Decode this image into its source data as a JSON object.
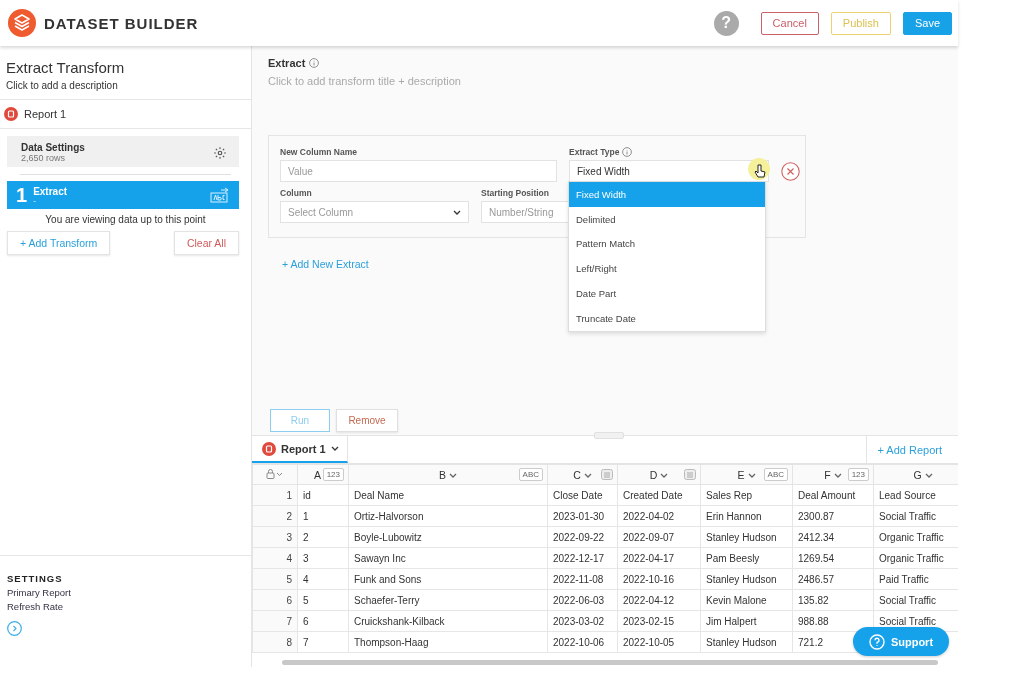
{
  "header": {
    "title": "DATASET BUILDER",
    "help": "?",
    "buttons": [
      {
        "label": "Cancel",
        "kind": "cancel"
      },
      {
        "label": "Publish",
        "kind": "publish"
      },
      {
        "label": "Save",
        "kind": "save"
      }
    ]
  },
  "sidebar": {
    "title": "Extract Transform",
    "description": "Click to add a description",
    "report": "Report 1",
    "data_settings": {
      "title": "Data Settings",
      "rows": "2,650 rows"
    },
    "steps": [
      {
        "number": "1",
        "title": "Extract",
        "subtitle": "-",
        "selected": true
      }
    ],
    "viewing_note": "You are viewing data up to this point",
    "buttons": [
      {
        "label": "+ Add Transform",
        "kind": "add"
      },
      {
        "label": "Clear All",
        "kind": "clear"
      }
    ],
    "settings": {
      "heading": "SETTINGS",
      "items": [
        "Primary Report",
        "Refresh Rate"
      ]
    }
  },
  "transform": {
    "title": "Extract",
    "description": "Click to add transform title + description",
    "fields": {
      "new_column_label": "New Column Name",
      "new_column_placeholder": "Value",
      "extract_type_label": "Extract Type",
      "extract_type_value": "Fixed Width",
      "column_label": "Column",
      "column_placeholder": "Select Column",
      "start_label": "Starting Position",
      "start_placeholder": "Number/String"
    },
    "dropdown": [
      {
        "label": "Fixed Width",
        "selected": true
      },
      {
        "label": "Delimited",
        "selected": false
      },
      {
        "label": "Pattern Match",
        "selected": false
      },
      {
        "label": "Left/Right",
        "selected": false
      },
      {
        "label": "Date Part",
        "selected": false
      },
      {
        "label": "Truncate Date",
        "selected": false
      }
    ],
    "add_extract": "+ Add New Extract",
    "actions": [
      {
        "label": "Run",
        "kind": "run"
      },
      {
        "label": "Remove",
        "kind": "remove"
      }
    ]
  },
  "grid": {
    "tabs": [
      {
        "label": "Report 1",
        "selected": true
      }
    ],
    "add_report": "+ Add Report",
    "columns": [
      {
        "letter": "A",
        "kind": "badge",
        "badge": "123"
      },
      {
        "letter": "B",
        "kind": "badge",
        "badge": "ABC"
      },
      {
        "letter": "C",
        "kind": "date"
      },
      {
        "letter": "D",
        "kind": "date"
      },
      {
        "letter": "E",
        "kind": "badge",
        "badge": "ABC"
      },
      {
        "letter": "F",
        "kind": "badge",
        "badge": "123"
      },
      {
        "letter": "G",
        "kind": "none"
      }
    ],
    "rows": [
      {
        "num": "1",
        "cells": [
          "id",
          "Deal Name",
          "Close Date",
          "Created Date",
          "Sales Rep",
          "Deal Amount",
          "Lead Source"
        ]
      },
      {
        "num": "2",
        "cells": [
          "1",
          "Ortiz-Halvorson",
          "2023-01-30",
          "2022-04-02",
          "Erin Hannon",
          "2300.87",
          "Social Traffic"
        ]
      },
      {
        "num": "3",
        "cells": [
          "2",
          "Boyle-Lubowitz",
          "2022-09-22",
          "2022-09-07",
          "Stanley Hudson",
          "2412.34",
          "Organic Traffic"
        ]
      },
      {
        "num": "4",
        "cells": [
          "3",
          "Sawayn Inc",
          "2022-12-17",
          "2022-04-17",
          "Pam Beesly",
          "1269.54",
          "Organic Traffic"
        ]
      },
      {
        "num": "5",
        "cells": [
          "4",
          "Funk and Sons",
          "2022-11-08",
          "2022-10-16",
          "Stanley Hudson",
          "2486.57",
          "Paid Traffic"
        ]
      },
      {
        "num": "6",
        "cells": [
          "5",
          "Schaefer-Terry",
          "2022-06-03",
          "2022-04-12",
          "Kevin Malone",
          "135.82",
          "Social Traffic"
        ]
      },
      {
        "num": "7",
        "cells": [
          "6",
          "Cruickshank-Kilback",
          "2023-03-02",
          "2023-02-15",
          "Jim Halpert",
          "988.88",
          "Social Traffic"
        ]
      },
      {
        "num": "8",
        "cells": [
          "7",
          "Thompson-Haag",
          "2022-10-06",
          "2022-10-05",
          "Stanley Hudson",
          "721.2"
        ]
      }
    ]
  },
  "support": "Support"
}
